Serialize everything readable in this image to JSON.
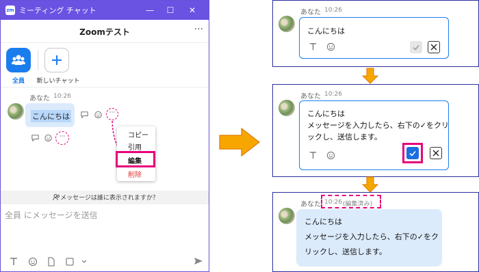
{
  "window": {
    "app_icon_text": "zm",
    "title": "ミーティング チャット",
    "min_glyph": "—",
    "max_glyph": "☐",
    "close_glyph": "✕"
  },
  "chat": {
    "title": "Zoomテスト",
    "more_glyph": "···"
  },
  "nav": {
    "everyone_label": "全員",
    "new_chat_label": "新しいチャット"
  },
  "message_left": {
    "sender": "あなた",
    "time": "10:26",
    "text": "こんにちは",
    "dots": "···"
  },
  "context_menu": {
    "items": [
      "コピー",
      "引用",
      "編集",
      "削除"
    ]
  },
  "visibility_text": "メッセージは誰に表示されますか？",
  "compose": {
    "placeholder": "全員 にメッセージを送信"
  },
  "panel1": {
    "sender": "あなた",
    "time": "10:26",
    "text": "こんにちは"
  },
  "panel2": {
    "sender": "あなた",
    "time": "10:26",
    "lines": [
      "こんにちは",
      "メッセージを入力したら、右下の✓をクリ",
      "ックし、送信します。"
    ]
  },
  "panel3": {
    "sender": "あなた",
    "time": "10:26",
    "edited_tag": "(編集済み)",
    "lines": [
      "こんにちは",
      "メッセージを入力したら、右下の✓をク",
      "リックし、送信します。"
    ]
  },
  "colors": {
    "titlebar": "#6a52e3",
    "accent": "#1a7dee",
    "highlight": "#e6007a",
    "arrow": "#f5a400",
    "panel_border": "#2b2f9a"
  }
}
